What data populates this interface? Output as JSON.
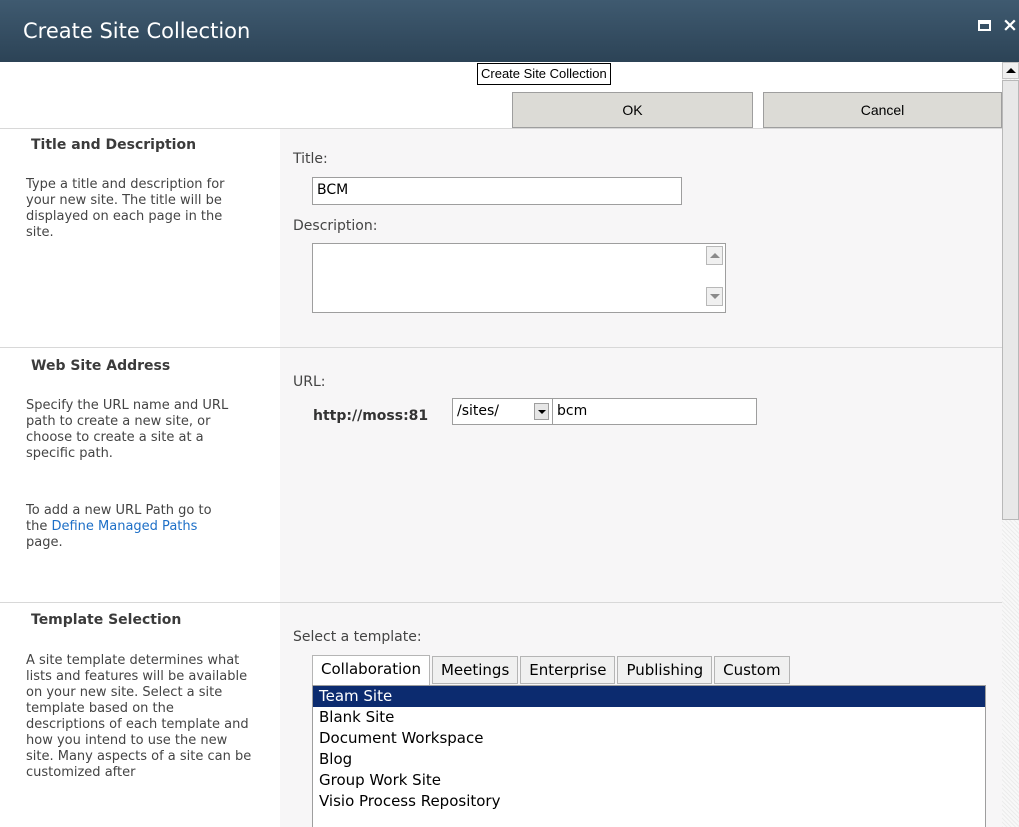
{
  "window": {
    "title": "Create Site Collection"
  },
  "tooltip": "Create Site Collection",
  "buttons": {
    "ok": "OK",
    "cancel": "Cancel"
  },
  "sections": {
    "title_desc": {
      "heading": "Title and Description",
      "description": "Type a title and description for your new site. The title will be displayed on each page in the site.",
      "title_label": "Title:",
      "title_value": "BCM",
      "description_label": "Description:",
      "description_value": ""
    },
    "web_address": {
      "heading": "Web Site Address",
      "description": "Specify the URL name and URL path to create a new site, or choose to create a site at a specific path.",
      "note_before": "To add a new URL Path go to the ",
      "note_link": "Define Managed Paths",
      "note_after": " page.",
      "url_label": "URL:",
      "url_prefix": "http://moss:81",
      "path_selected": "/sites/",
      "url_value": "bcm"
    },
    "template": {
      "heading": "Template Selection",
      "description": "A site template determines what lists and features will be available on your new site. Select a site template based on the descriptions of each template and how you intend to use the new site. Many aspects of a site can be customized after",
      "select_label": "Select a template:",
      "tabs": [
        "Collaboration",
        "Meetings",
        "Enterprise",
        "Publishing",
        "Custom"
      ],
      "active_tab": "Collaboration",
      "items": [
        "Team Site",
        "Blank Site",
        "Document Workspace",
        "Blog",
        "Group Work Site",
        "Visio Process Repository"
      ],
      "selected_item": "Team Site"
    }
  },
  "colors": {
    "titlebar": "#2f4a5f",
    "selection": "#0c2b6f",
    "link": "#1d6fc7"
  }
}
